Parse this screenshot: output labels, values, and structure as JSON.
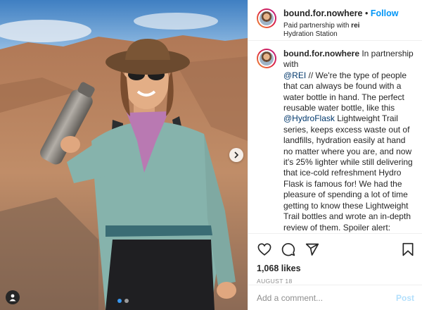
{
  "header": {
    "username": "bound.for.nowhere",
    "separator": "•",
    "follow_label": "Follow",
    "partnership_prefix": "Paid partnership with ",
    "partner_name": "rei",
    "location": "Hydration Station"
  },
  "caption": {
    "username": "bound.for.nowhere",
    "intro": " In partnership with ",
    "mention_rei": "@REI",
    "text_1": " // We're the type of people that can always be found with a water bottle in hand. The perfect reusable water bottle, like this ",
    "mention_hydroflask": "@HydroFlask",
    "text_2": " Lightweight Trail series, keeps excess waste out of landfills, hydration easily at hand no matter where you are, and now it's 25% lighter while still delivering that ice-cold refreshment Hydro Flask is famous for! We had the pleasure of spending a lot of time getting to know these Lightweight Trail bottles and wrote an in-depth review of them. Spoiler alert: These Lightweight Trail Series bottles have completely changed our mind about bringing a water bottle vs a water bladder on trail! There is nothing better than hours into a hike and still having cold water to drink."
  },
  "actions": {
    "icons": [
      "heart-icon",
      "comment-icon",
      "share-icon",
      "bookmark-icon"
    ],
    "likes": "1,068 likes",
    "date": "AUGUST 18"
  },
  "add_comment": {
    "placeholder": "Add a comment...",
    "post_label": "Post"
  },
  "carousel": {
    "slide_count": 2,
    "active_index": 0
  },
  "colors": {
    "link": "#0095f6",
    "mention": "#00376b",
    "post_disabled": "#b2dffc",
    "shirt": "#86b3ac",
    "hat": "#6b4a2f",
    "bandana": "#b979b2",
    "bottle": "#8f8a84"
  }
}
